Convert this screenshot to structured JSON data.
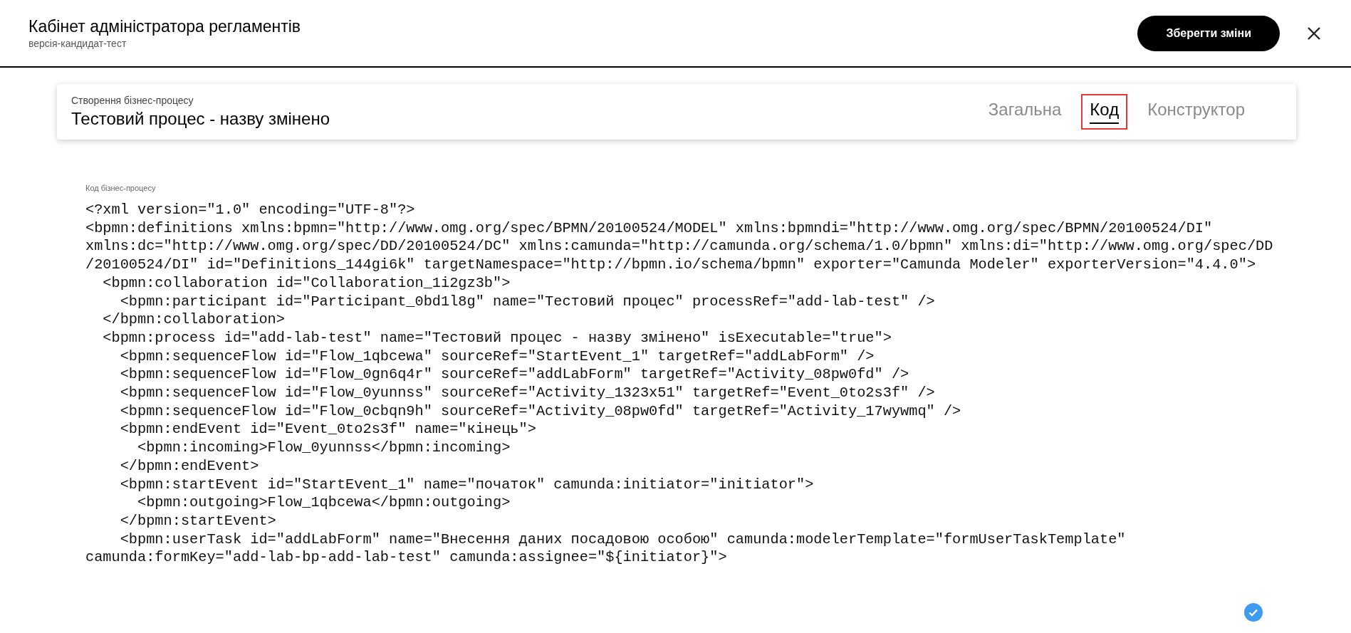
{
  "header": {
    "title": "Кабінет адміністратора регламентів",
    "subtitle": "версія-кандидат-тест",
    "save_button": "Зберегти зміни"
  },
  "process_card": {
    "caption": "Створення бізнес-процесу",
    "title": "Тестовий процес - назву змінено",
    "tabs": [
      {
        "label": "Загальна",
        "selected": false
      },
      {
        "label": "Код",
        "selected": true
      },
      {
        "label": "Конструктор",
        "selected": false
      }
    ]
  },
  "code_editor": {
    "label": "Код бізнес-процесу",
    "lines": [
      "<?xml version=\"1.0\" encoding=\"UTF-8\"?>",
      "<bpmn:definitions xmlns:bpmn=\"http://www.omg.org/spec/BPMN/20100524/MODEL\" xmlns:bpmndi=\"http://www.omg.org/spec/BPMN/20100524/DI\"",
      "xmlns:dc=\"http://www.omg.org/spec/DD/20100524/DC\" xmlns:camunda=\"http://camunda.org/schema/1.0/bpmn\" xmlns:di=\"http://www.omg.org/spec/DD",
      "/20100524/DI\" id=\"Definitions_144gi6k\" targetNamespace=\"http://bpmn.io/schema/bpmn\" exporter=\"Camunda Modeler\" exporterVersion=\"4.4.0\">",
      "  <bpmn:collaboration id=\"Collaboration_1i2gz3b\">",
      "    <bpmn:participant id=\"Participant_0bd1l8g\" name=\"Тестовий процес\" processRef=\"add-lab-test\" />",
      "  </bpmn:collaboration>",
      "  <bpmn:process id=\"add-lab-test\" name=\"Тестовий процес - назву змінено\" isExecutable=\"true\">",
      "    <bpmn:sequenceFlow id=\"Flow_1qbcewa\" sourceRef=\"StartEvent_1\" targetRef=\"addLabForm\" />",
      "    <bpmn:sequenceFlow id=\"Flow_0gn6q4r\" sourceRef=\"addLabForm\" targetRef=\"Activity_08pw0fd\" />",
      "    <bpmn:sequenceFlow id=\"Flow_0yunnss\" sourceRef=\"Activity_1323x51\" targetRef=\"Event_0to2s3f\" />",
      "    <bpmn:sequenceFlow id=\"Flow_0cbqn9h\" sourceRef=\"Activity_08pw0fd\" targetRef=\"Activity_17wywmq\" />",
      "    <bpmn:endEvent id=\"Event_0to2s3f\" name=\"кінець\">",
      "      <bpmn:incoming>Flow_0yunnss</bpmn:incoming>",
      "    </bpmn:endEvent>",
      "    <bpmn:startEvent id=\"StartEvent_1\" name=\"початок\" camunda:initiator=\"initiator\">",
      "      <bpmn:outgoing>Flow_1qbcewa</bpmn:outgoing>",
      "    </bpmn:startEvent>",
      "    <bpmn:userTask id=\"addLabForm\" name=\"Внесення даних посадовою особою\" camunda:modelerTemplate=\"formUserTaskTemplate\"",
      "camunda:formKey=\"add-lab-bp-add-lab-test\" camunda:assignee=\"${initiator}\">"
    ]
  }
}
